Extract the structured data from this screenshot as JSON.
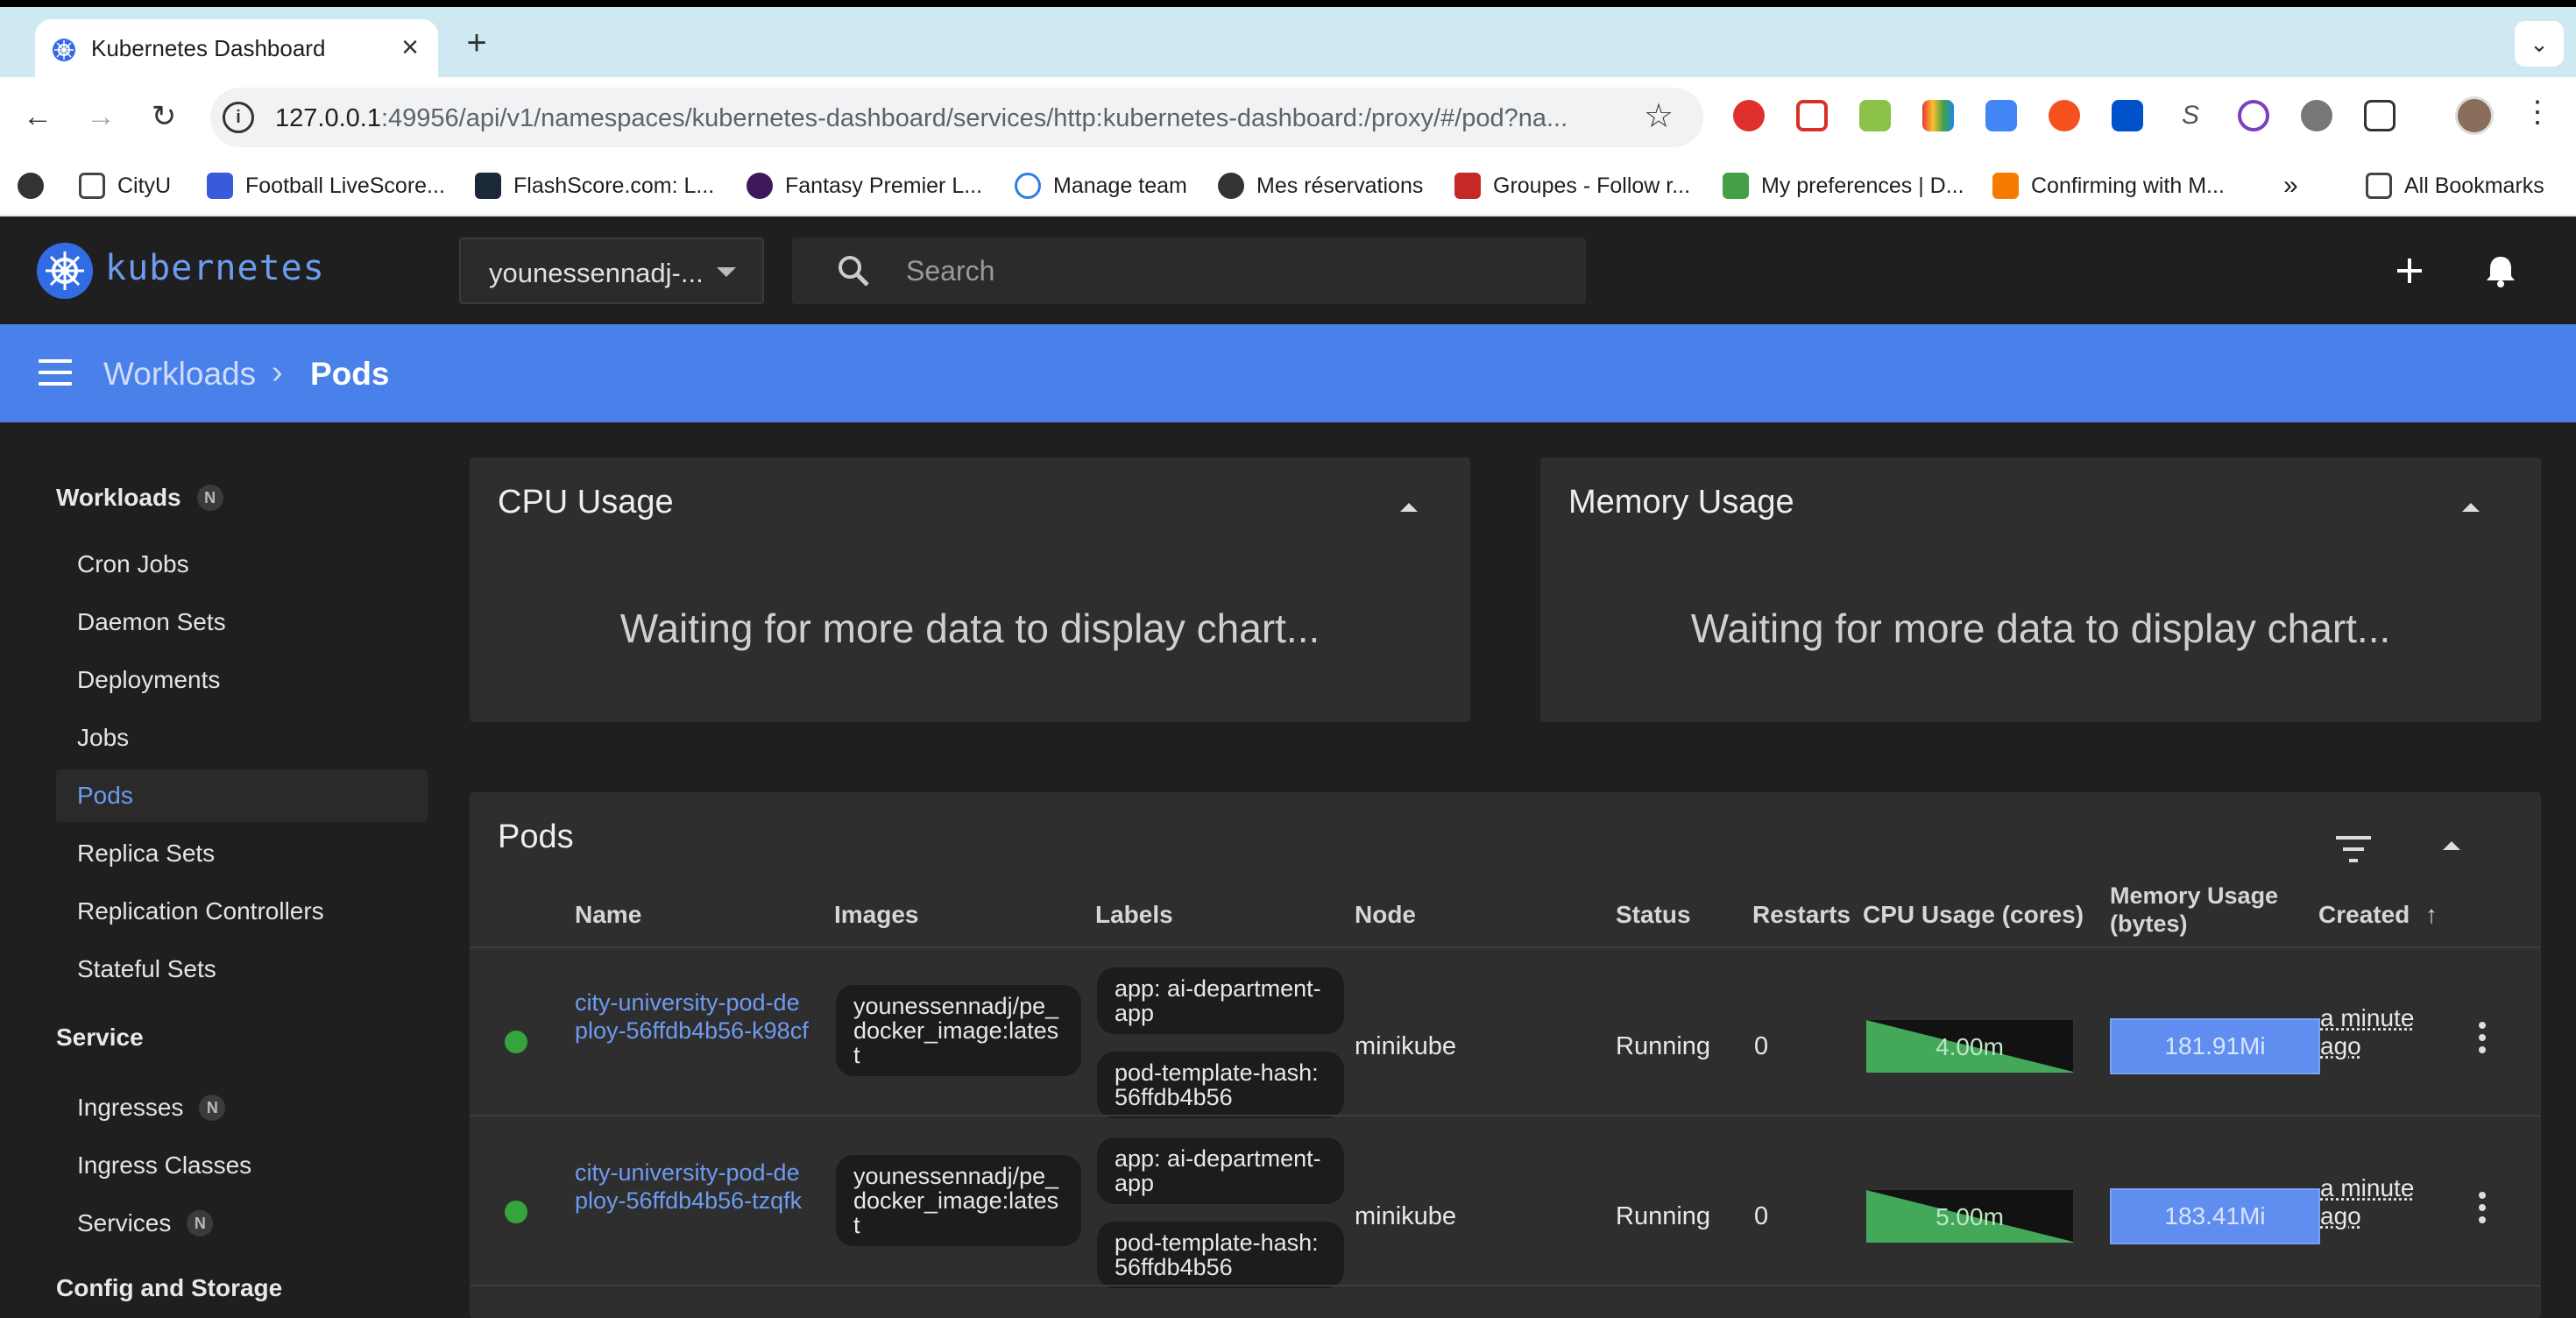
{
  "browser": {
    "tab_title": "Kubernetes Dashboard",
    "url_host": "127.0.0.1",
    "url_rest": ":49956/api/v1/namespaces/kubernetes-dashboard/services/http:kubernetes-dashboard:/proxy/#/pod?na...",
    "bookmarks": [
      "CityU",
      "Football LiveScore...",
      "FlashScore.com: L...",
      "Fantasy Premier L...",
      "Manage team",
      "Mes réservations",
      "Groupes - Follow r...",
      "My preferences | D...",
      "Confirming with M..."
    ],
    "all_bookmarks": "All Bookmarks"
  },
  "app": {
    "logo_text": "kubernetes",
    "namespace": "younessennadj-...",
    "search_placeholder": "Search"
  },
  "breadcrumb": {
    "parent": "Workloads",
    "current": "Pods"
  },
  "sidebar": {
    "workloads": "Workloads",
    "n": "N",
    "workload_items": [
      "Cron Jobs",
      "Daemon Sets",
      "Deployments",
      "Jobs",
      "Pods",
      "Replica Sets",
      "Replication Controllers",
      "Stateful Sets"
    ],
    "service": "Service",
    "service_items": [
      "Ingresses",
      "Ingress Classes",
      "Services"
    ],
    "config": "Config and Storage"
  },
  "cpu_card": {
    "title": "CPU Usage",
    "message": "Waiting for more data to display chart..."
  },
  "memory_card": {
    "title": "Memory Usage",
    "message": "Waiting for more data to display chart..."
  },
  "pods": {
    "title": "Pods",
    "columns": {
      "name": "Name",
      "images": "Images",
      "labels": "Labels",
      "node": "Node",
      "status": "Status",
      "restarts": "Restarts",
      "cpu": "CPU Usage (cores)",
      "memory_1": "Memory Usage",
      "memory_2": "(bytes)",
      "created": "Created"
    },
    "rows": [
      {
        "name": "city-university-pod-deploy-56ffdb4b56-k98cf",
        "image": "younessennadj/pe_docker_image:latest",
        "label1": "app: ai-department-app",
        "label2": "pod-template-hash: 56ffdb4b56",
        "node": "minikube",
        "status": "Running",
        "restarts": "0",
        "cpu": "4.00m",
        "memory": "181.91Mi",
        "created": "a minute ago"
      },
      {
        "name": "city-university-pod-deploy-56ffdb4b56-tzqfk",
        "image": "younessennadj/pe_docker_image:latest",
        "label1": "app: ai-department-app",
        "label2": "pod-template-hash: 56ffdb4b56",
        "node": "minikube",
        "status": "Running",
        "restarts": "0",
        "cpu": "5.00m",
        "memory": "183.41Mi",
        "created": "a minute ago"
      }
    ]
  },
  "colors": {
    "accent": "#326ce5",
    "crumbbar": "#4a80ea",
    "running": "#35a43c",
    "cpu": "#3fa552",
    "memory": "#5f8ef0"
  }
}
